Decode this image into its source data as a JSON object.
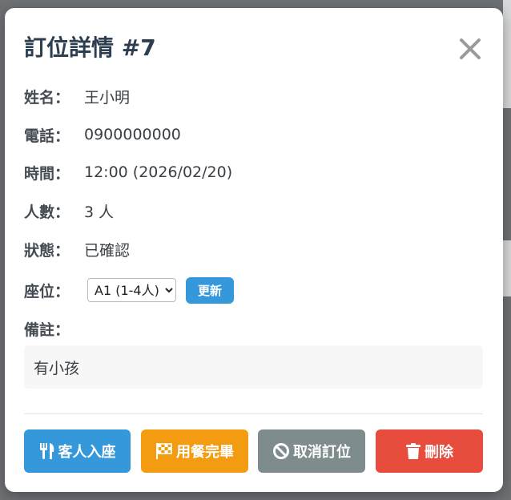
{
  "modal": {
    "title": "訂位詳情 #7",
    "close_symbol": "×"
  },
  "fields": {
    "name_label": "姓名：",
    "name_value": "王小明",
    "phone_label": "電話：",
    "phone_value": "0900000000",
    "time_label": "時間：",
    "time_value": "12:00 (2026/02/20)",
    "people_label": "人數：",
    "people_value": "3 人",
    "status_label": "狀態：",
    "status_value": "已確認",
    "seat_label": "座位：",
    "seat_selected": "A1 (1-4人)",
    "update_label": "更新",
    "note_label": "備註：",
    "note_value": "有小孩"
  },
  "actions": {
    "seat_guest": "客人入座",
    "finish_meal": "用餐完畢",
    "cancel_booking": "取消訂位",
    "delete": "刪除"
  },
  "icons": {
    "close": "close-icon",
    "seat_guest": "utensils-icon",
    "finish_meal": "checkered-flag-icon",
    "cancel_booking": "ban-icon",
    "delete": "trash-icon"
  },
  "colors": {
    "primary": "#3498db",
    "warning": "#f39c12",
    "secondary": "#7f8c8d",
    "danger": "#e74c3c",
    "title": "#2c3e50"
  }
}
